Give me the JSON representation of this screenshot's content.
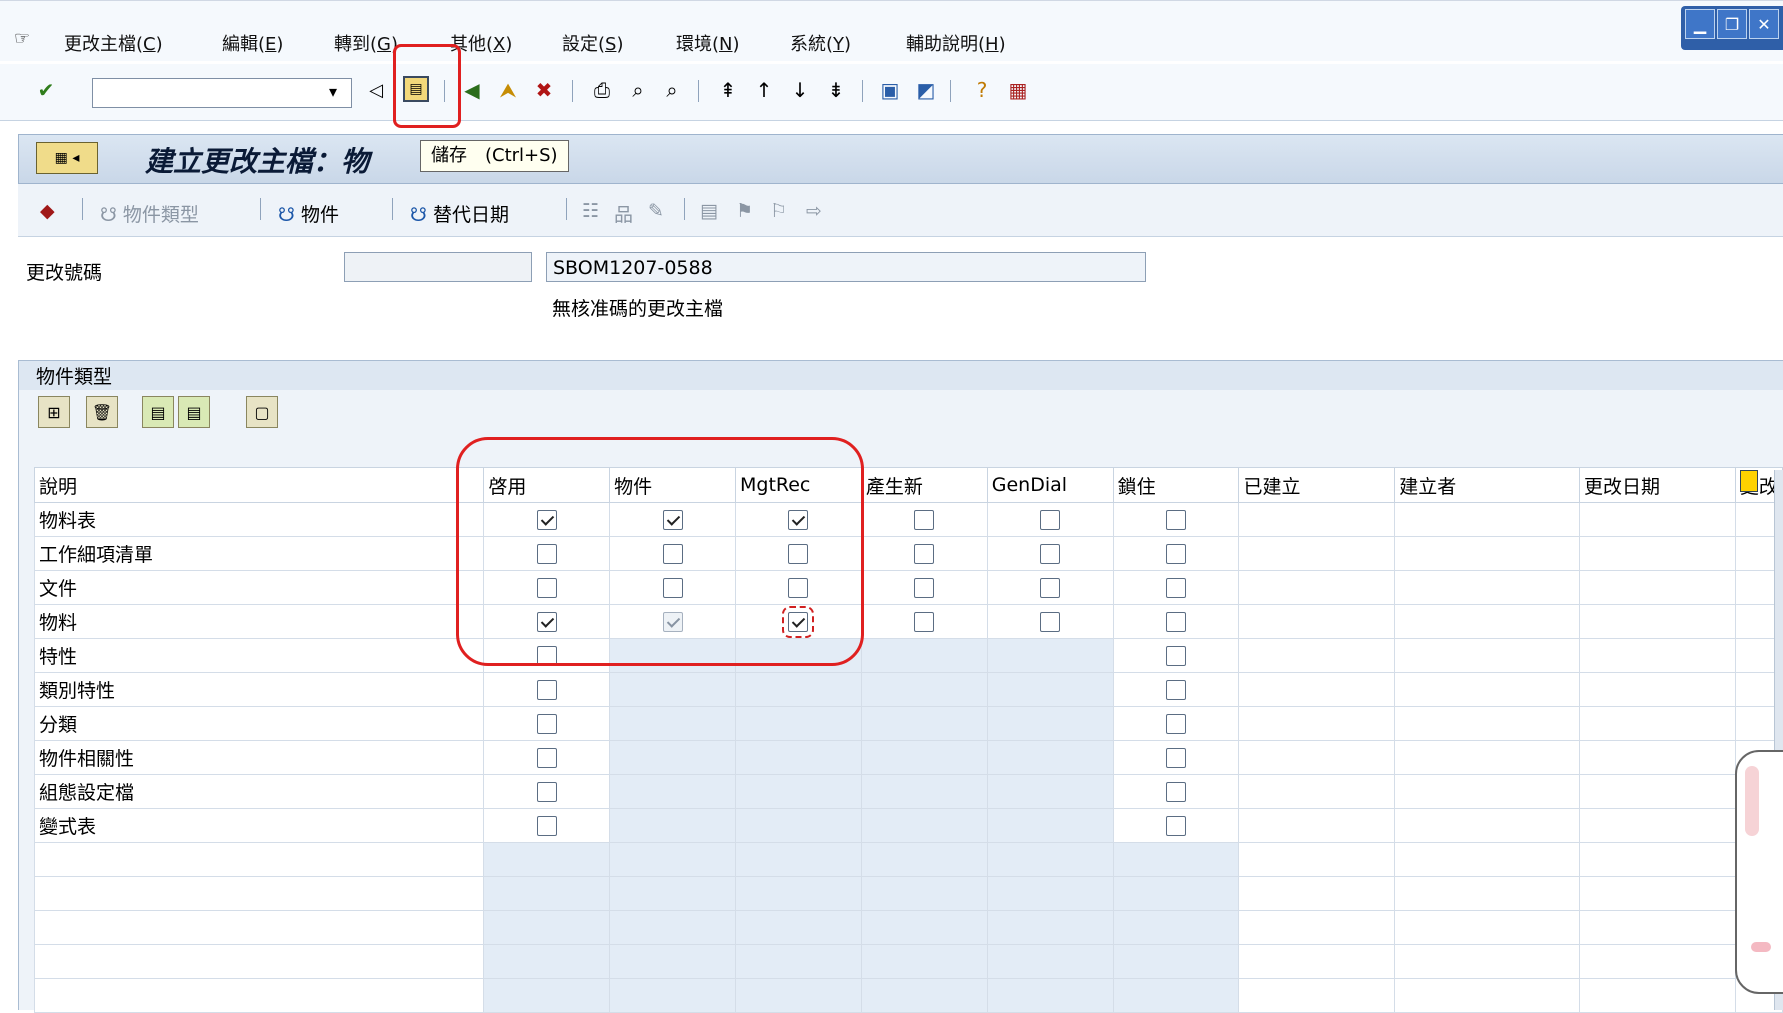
{
  "menu": {
    "items": [
      {
        "label": "更改主檔(",
        "key": "C",
        "end": ")"
      },
      {
        "label": "編輯(",
        "key": "E",
        "end": ")"
      },
      {
        "label": "轉到(",
        "key": "G",
        "end": ")"
      },
      {
        "label": "其他(",
        "key": "X",
        "end": ")"
      },
      {
        "label": "設定(",
        "key": "S",
        "end": ")"
      },
      {
        "label": "環境(",
        "key": "N",
        "end": ")"
      },
      {
        "label": "系統(",
        "key": "Y",
        "end": ")"
      },
      {
        "label": "輔助說明(",
        "key": "H",
        "end": ")"
      }
    ]
  },
  "toolbar": {
    "command_value": "",
    "icons": [
      "enter-icon",
      "back-icon",
      "exit-icon",
      "cancel-icon",
      "print-icon",
      "find-icon",
      "find-next-icon",
      "first-page-icon",
      "prev-page-icon",
      "next-page-icon",
      "last-page-icon",
      "new-session-icon",
      "shortcut-icon",
      "help-icon",
      "layout-icon"
    ]
  },
  "title": {
    "text": "建立更改主檔：物",
    "tooltip": "儲存　(Ctrl+S)"
  },
  "app_toolbar": {
    "obj_type_label": "物件類型",
    "object_label": "物件",
    "alt_date_label": "替代日期"
  },
  "header": {
    "change_no_label": "更改號碼",
    "change_no_value": "SBOM1207-0588",
    "description": "無核准碼的更改主檔"
  },
  "section": {
    "title": "物件類型"
  },
  "table": {
    "columns": [
      "說明",
      "啓用",
      "物件",
      "MgtRec",
      "產生新",
      "GenDial",
      "鎖住",
      "已建立",
      "建立者",
      "更改日期",
      "更改"
    ],
    "rows": [
      {
        "desc": "物料表",
        "active": true,
        "object": true,
        "mgtrec": true,
        "gen": false,
        "gendial": false,
        "locked": false
      },
      {
        "desc": "工作細項清單",
        "active": false,
        "object": false,
        "mgtrec": false,
        "gen": false,
        "gendial": false,
        "locked": false
      },
      {
        "desc": "文件",
        "active": false,
        "object": false,
        "mgtrec": false,
        "gen": false,
        "gendial": false,
        "locked": false
      },
      {
        "desc": "物料",
        "active": true,
        "object": true,
        "mgtrec": true,
        "gen": false,
        "gendial": false,
        "locked": false
      },
      {
        "desc": "特性",
        "active": false,
        "locked": false
      },
      {
        "desc": "類別特性",
        "active": false,
        "locked": false
      },
      {
        "desc": "分類",
        "active": false,
        "locked": false
      },
      {
        "desc": "物件相關性",
        "active": false,
        "locked": false
      },
      {
        "desc": "組態設定檔",
        "active": false,
        "locked": false
      },
      {
        "desc": "變式表",
        "active": false,
        "locked": false
      }
    ],
    "empty_rows": 5
  }
}
